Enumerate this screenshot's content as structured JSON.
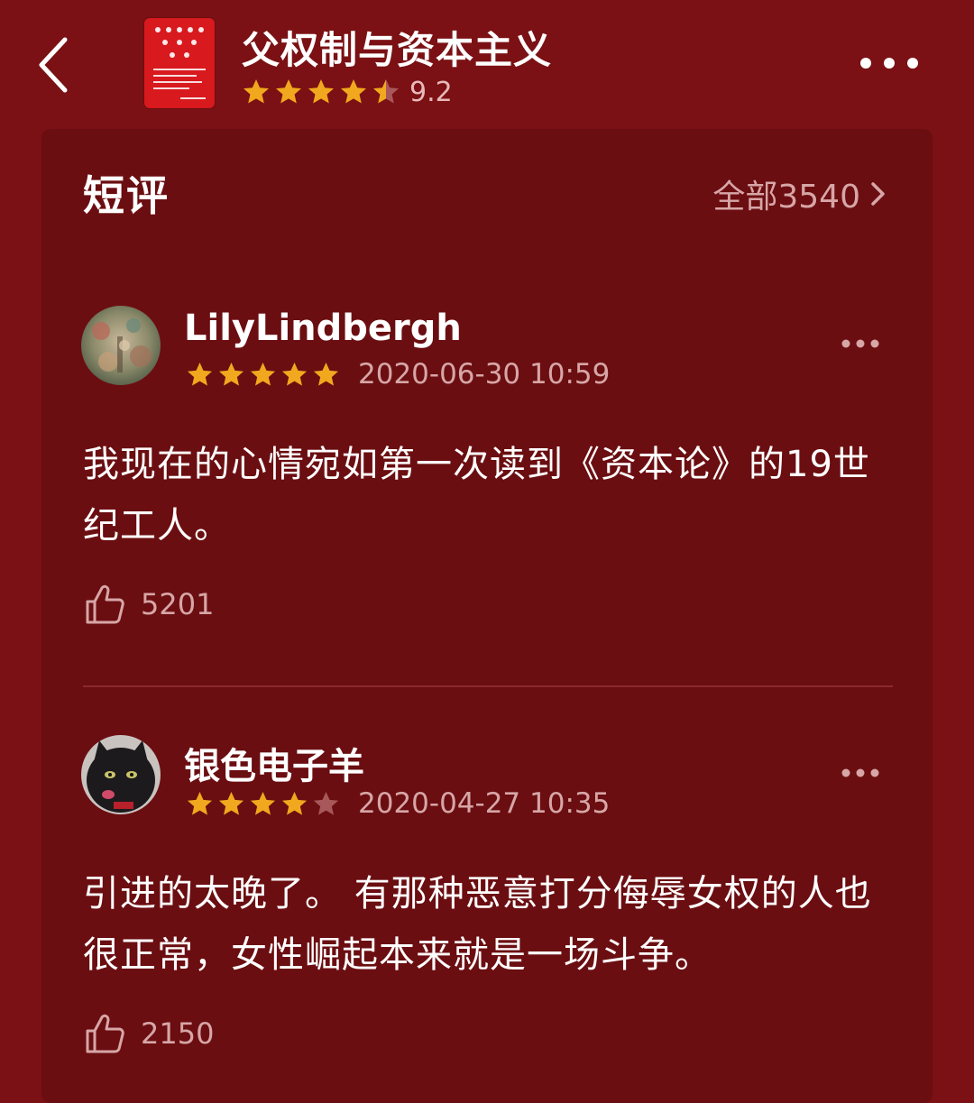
{
  "header": {
    "back_icon": "chevron-left-icon",
    "book_title": "父权制与资本主义",
    "rating_stars": 4.5,
    "rating_score": "9.2",
    "more_icon": "more-horizontal-icon"
  },
  "section": {
    "title": "短评",
    "all_label": "全部3540",
    "all_icon": "chevron-right-icon"
  },
  "reviews": [
    {
      "username": "LilyLindbergh",
      "stars": 5,
      "date": "2020-06-30 10:59",
      "text": "我现在的心情宛如第一次读到《资本论》的19世纪工人。",
      "likes": "5201"
    },
    {
      "username": "银色电子羊",
      "stars": 4,
      "date": "2020-04-27 10:35",
      "text": "引进的太晚了。 有那种恶意打分侮辱女权的人也很正常，女性崛起本来就是一场斗争。",
      "likes": "2150"
    }
  ],
  "colors": {
    "background": "#7b1114",
    "card": "#6b0e11",
    "star_filled": "#f2a81e",
    "star_empty": "#a8585b",
    "muted_text": "#d7a6a7",
    "divider": "#8a2a2d"
  }
}
